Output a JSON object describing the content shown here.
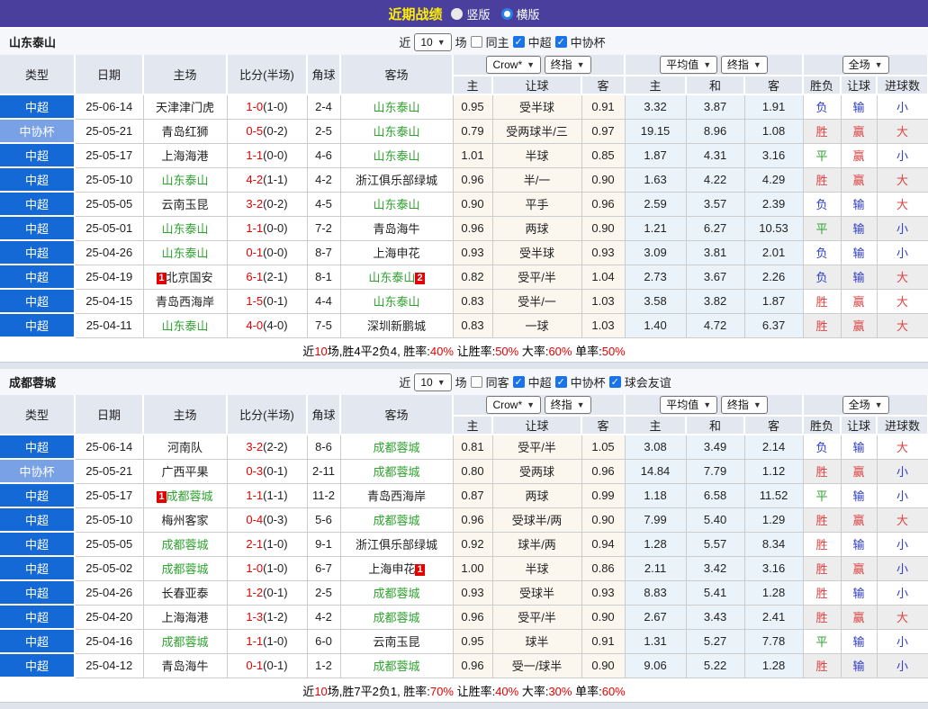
{
  "topbar": {
    "title": "近期战绩",
    "radios": [
      {
        "label": "竖版",
        "style": "filled"
      },
      {
        "label": "横版",
        "style": "ring"
      }
    ]
  },
  "colors": {
    "league_badge": "#1569d6",
    "cup_badge": "#79a1e6",
    "team_green": "#2fa32f",
    "score_red": "#e60000",
    "topbar_bg": "#4a3f9c",
    "title_yellow": "#ffef00",
    "result_map": {
      "胜": "#dd4444",
      "赢": "#dd4444",
      "大": "#dd4444",
      "平": "#2fa32f",
      "负": "#2f3cc8",
      "输": "#2f3cc8",
      "小": "#2f3cc8"
    }
  },
  "table_header": {
    "cols": [
      "类型",
      "日期",
      "主场",
      "比分(半场)",
      "角球",
      "客场"
    ],
    "groups": [
      {
        "selects": [
          "Crow*",
          "终指"
        ],
        "cols": [
          "主",
          "让球",
          "客"
        ]
      },
      {
        "selects": [
          "平均值",
          "终指"
        ],
        "cols": [
          "主",
          "和",
          "客"
        ]
      },
      {
        "selects": [
          "全场"
        ],
        "cols": [
          "胜负",
          "让球",
          "进球数"
        ]
      }
    ]
  },
  "sections": [
    {
      "team": "山东泰山",
      "filter": {
        "near": "近",
        "count": "10",
        "games": "场",
        "checks": [
          {
            "label": "同主",
            "on": false
          },
          {
            "label": "中超",
            "on": true
          },
          {
            "label": "中协杯",
            "on": true
          }
        ]
      },
      "rows": [
        {
          "t": "中超",
          "cup": false,
          "d": "25-06-14",
          "h": "天津津门虎",
          "hg": false,
          "hbadge": "",
          "s": "1-0",
          "hf": "(1-0)",
          "c": "2-4",
          "a": "山东泰山",
          "ag": true,
          "abadge": "",
          "o": [
            "0.95",
            "受半球",
            "0.91"
          ],
          "v": [
            "3.32",
            "3.87",
            "1.91"
          ],
          "r": [
            "负",
            "输",
            "小"
          ]
        },
        {
          "t": "中协杯",
          "cup": true,
          "d": "25-05-21",
          "h": "青岛红狮",
          "hg": false,
          "hbadge": "",
          "s": "0-5",
          "hf": "(0-2)",
          "c": "2-5",
          "a": "山东泰山",
          "ag": true,
          "abadge": "",
          "o": [
            "0.79",
            "受两球半/三",
            "0.97"
          ],
          "v": [
            "19.15",
            "8.96",
            "1.08"
          ],
          "r": [
            "胜",
            "赢",
            "大"
          ]
        },
        {
          "t": "中超",
          "cup": false,
          "d": "25-05-17",
          "h": "上海海港",
          "hg": false,
          "hbadge": "",
          "s": "1-1",
          "hf": "(0-0)",
          "c": "4-6",
          "a": "山东泰山",
          "ag": true,
          "abadge": "",
          "o": [
            "1.01",
            "半球",
            "0.85"
          ],
          "v": [
            "1.87",
            "4.31",
            "3.16"
          ],
          "r": [
            "平",
            "赢",
            "小"
          ]
        },
        {
          "t": "中超",
          "cup": false,
          "d": "25-05-10",
          "h": "山东泰山",
          "hg": true,
          "hbadge": "",
          "s": "4-2",
          "hf": "(1-1)",
          "c": "4-2",
          "a": "浙江俱乐部绿城",
          "ag": false,
          "abadge": "",
          "o": [
            "0.96",
            "半/一",
            "0.90"
          ],
          "v": [
            "1.63",
            "4.22",
            "4.29"
          ],
          "r": [
            "胜",
            "赢",
            "大"
          ]
        },
        {
          "t": "中超",
          "cup": false,
          "d": "25-05-05",
          "h": "云南玉昆",
          "hg": false,
          "hbadge": "",
          "s": "3-2",
          "hf": "(0-2)",
          "c": "4-5",
          "a": "山东泰山",
          "ag": true,
          "abadge": "",
          "o": [
            "0.90",
            "平手",
            "0.96"
          ],
          "v": [
            "2.59",
            "3.57",
            "2.39"
          ],
          "r": [
            "负",
            "输",
            "大"
          ]
        },
        {
          "t": "中超",
          "cup": false,
          "d": "25-05-01",
          "h": "山东泰山",
          "hg": true,
          "hbadge": "",
          "s": "1-1",
          "hf": "(0-0)",
          "c": "7-2",
          "a": "青岛海牛",
          "ag": false,
          "abadge": "",
          "o": [
            "0.96",
            "两球",
            "0.90"
          ],
          "v": [
            "1.21",
            "6.27",
            "10.53"
          ],
          "r": [
            "平",
            "输",
            "小"
          ]
        },
        {
          "t": "中超",
          "cup": false,
          "d": "25-04-26",
          "h": "山东泰山",
          "hg": true,
          "hbadge": "",
          "s": "0-1",
          "hf": "(0-0)",
          "c": "8-7",
          "a": "上海申花",
          "ag": false,
          "abadge": "",
          "o": [
            "0.93",
            "受半球",
            "0.93"
          ],
          "v": [
            "3.09",
            "3.81",
            "2.01"
          ],
          "r": [
            "负",
            "输",
            "小"
          ]
        },
        {
          "t": "中超",
          "cup": false,
          "d": "25-04-19",
          "h": "北京国安",
          "hg": false,
          "hbadge": "1",
          "s": "6-1",
          "hf": "(2-1)",
          "c": "8-1",
          "a": "山东泰山",
          "ag": true,
          "abadge": "2",
          "o": [
            "0.82",
            "受平/半",
            "1.04"
          ],
          "v": [
            "2.73",
            "3.67",
            "2.26"
          ],
          "r": [
            "负",
            "输",
            "大"
          ]
        },
        {
          "t": "中超",
          "cup": false,
          "d": "25-04-15",
          "h": "青岛西海岸",
          "hg": false,
          "hbadge": "",
          "s": "1-5",
          "hf": "(0-1)",
          "c": "4-4",
          "a": "山东泰山",
          "ag": true,
          "abadge": "",
          "o": [
            "0.83",
            "受半/一",
            "1.03"
          ],
          "v": [
            "3.58",
            "3.82",
            "1.87"
          ],
          "r": [
            "胜",
            "赢",
            "大"
          ]
        },
        {
          "t": "中超",
          "cup": false,
          "d": "25-04-11",
          "h": "山东泰山",
          "hg": true,
          "hbadge": "",
          "s": "4-0",
          "hf": "(4-0)",
          "c": "7-5",
          "a": "深圳新鹏城",
          "ag": false,
          "abadge": "",
          "o": [
            "0.83",
            "一球",
            "1.03"
          ],
          "v": [
            "1.40",
            "4.72",
            "6.37"
          ],
          "r": [
            "胜",
            "赢",
            "大"
          ]
        }
      ],
      "summary": [
        {
          "t": "近",
          "red": false
        },
        {
          "t": "10",
          "red": true
        },
        {
          "t": "场,胜4平2负4, 胜率:",
          "red": false
        },
        {
          "t": "40%",
          "red": true
        },
        {
          "t": " 让胜率:",
          "red": false
        },
        {
          "t": "50%",
          "red": true
        },
        {
          "t": " 大率:",
          "red": false
        },
        {
          "t": "60%",
          "red": true
        },
        {
          "t": " 单率:",
          "red": false
        },
        {
          "t": "50%",
          "red": true
        }
      ]
    },
    {
      "team": "成都蓉城",
      "filter": {
        "near": "近",
        "count": "10",
        "games": "场",
        "checks": [
          {
            "label": "同客",
            "on": false
          },
          {
            "label": "中超",
            "on": true
          },
          {
            "label": "中协杯",
            "on": true
          },
          {
            "label": "球会友谊",
            "on": true
          }
        ]
      },
      "rows": [
        {
          "t": "中超",
          "cup": false,
          "d": "25-06-14",
          "h": "河南队",
          "hg": false,
          "hbadge": "",
          "s": "3-2",
          "hf": "(2-2)",
          "c": "8-6",
          "a": "成都蓉城",
          "ag": true,
          "abadge": "",
          "o": [
            "0.81",
            "受平/半",
            "1.05"
          ],
          "v": [
            "3.08",
            "3.49",
            "2.14"
          ],
          "r": [
            "负",
            "输",
            "大"
          ]
        },
        {
          "t": "中协杯",
          "cup": true,
          "d": "25-05-21",
          "h": "广西平果",
          "hg": false,
          "hbadge": "",
          "s": "0-3",
          "hf": "(0-1)",
          "c": "2-11",
          "a": "成都蓉城",
          "ag": true,
          "abadge": "",
          "o": [
            "0.80",
            "受两球",
            "0.96"
          ],
          "v": [
            "14.84",
            "7.79",
            "1.12"
          ],
          "r": [
            "胜",
            "赢",
            "小"
          ]
        },
        {
          "t": "中超",
          "cup": false,
          "d": "25-05-17",
          "h": "成都蓉城",
          "hg": true,
          "hbadge": "1",
          "s": "1-1",
          "hf": "(1-1)",
          "c": "11-2",
          "a": "青岛西海岸",
          "ag": false,
          "abadge": "",
          "o": [
            "0.87",
            "两球",
            "0.99"
          ],
          "v": [
            "1.18",
            "6.58",
            "11.52"
          ],
          "r": [
            "平",
            "输",
            "小"
          ]
        },
        {
          "t": "中超",
          "cup": false,
          "d": "25-05-10",
          "h": "梅州客家",
          "hg": false,
          "hbadge": "",
          "s": "0-4",
          "hf": "(0-3)",
          "c": "5-6",
          "a": "成都蓉城",
          "ag": true,
          "abadge": "",
          "o": [
            "0.96",
            "受球半/两",
            "0.90"
          ],
          "v": [
            "7.99",
            "5.40",
            "1.29"
          ],
          "r": [
            "胜",
            "赢",
            "大"
          ]
        },
        {
          "t": "中超",
          "cup": false,
          "d": "25-05-05",
          "h": "成都蓉城",
          "hg": true,
          "hbadge": "",
          "s": "2-1",
          "hf": "(1-0)",
          "c": "9-1",
          "a": "浙江俱乐部绿城",
          "ag": false,
          "abadge": "",
          "o": [
            "0.92",
            "球半/两",
            "0.94"
          ],
          "v": [
            "1.28",
            "5.57",
            "8.34"
          ],
          "r": [
            "胜",
            "输",
            "小"
          ]
        },
        {
          "t": "中超",
          "cup": false,
          "d": "25-05-02",
          "h": "成都蓉城",
          "hg": true,
          "hbadge": "",
          "s": "1-0",
          "hf": "(1-0)",
          "c": "6-7",
          "a": "上海申花",
          "ag": false,
          "abadge": "1",
          "o": [
            "1.00",
            "半球",
            "0.86"
          ],
          "v": [
            "2.11",
            "3.42",
            "3.16"
          ],
          "r": [
            "胜",
            "赢",
            "小"
          ]
        },
        {
          "t": "中超",
          "cup": false,
          "d": "25-04-26",
          "h": "长春亚泰",
          "hg": false,
          "hbadge": "",
          "s": "1-2",
          "hf": "(0-1)",
          "c": "2-5",
          "a": "成都蓉城",
          "ag": true,
          "abadge": "",
          "o": [
            "0.93",
            "受球半",
            "0.93"
          ],
          "v": [
            "8.83",
            "5.41",
            "1.28"
          ],
          "r": [
            "胜",
            "输",
            "小"
          ]
        },
        {
          "t": "中超",
          "cup": false,
          "d": "25-04-20",
          "h": "上海海港",
          "hg": false,
          "hbadge": "",
          "s": "1-3",
          "hf": "(1-2)",
          "c": "4-2",
          "a": "成都蓉城",
          "ag": true,
          "abadge": "",
          "o": [
            "0.96",
            "受平/半",
            "0.90"
          ],
          "v": [
            "2.67",
            "3.43",
            "2.41"
          ],
          "r": [
            "胜",
            "赢",
            "大"
          ]
        },
        {
          "t": "中超",
          "cup": false,
          "d": "25-04-16",
          "h": "成都蓉城",
          "hg": true,
          "hbadge": "",
          "s": "1-1",
          "hf": "(1-0)",
          "c": "6-0",
          "a": "云南玉昆",
          "ag": false,
          "abadge": "",
          "o": [
            "0.95",
            "球半",
            "0.91"
          ],
          "v": [
            "1.31",
            "5.27",
            "7.78"
          ],
          "r": [
            "平",
            "输",
            "小"
          ]
        },
        {
          "t": "中超",
          "cup": false,
          "d": "25-04-12",
          "h": "青岛海牛",
          "hg": false,
          "hbadge": "",
          "s": "0-1",
          "hf": "(0-1)",
          "c": "1-2",
          "a": "成都蓉城",
          "ag": true,
          "abadge": "",
          "o": [
            "0.96",
            "受一/球半",
            "0.90"
          ],
          "v": [
            "9.06",
            "5.22",
            "1.28"
          ],
          "r": [
            "胜",
            "输",
            "小"
          ]
        }
      ],
      "summary": [
        {
          "t": "近",
          "red": false
        },
        {
          "t": "10",
          "red": true
        },
        {
          "t": "场,胜7平2负1, 胜率:",
          "red": false
        },
        {
          "t": "70%",
          "red": true
        },
        {
          "t": " 让胜率:",
          "red": false
        },
        {
          "t": "40%",
          "red": true
        },
        {
          "t": " 大率:",
          "red": false
        },
        {
          "t": "30%",
          "red": true
        },
        {
          "t": " 单率:",
          "red": false
        },
        {
          "t": "60%",
          "red": true
        }
      ]
    }
  ]
}
